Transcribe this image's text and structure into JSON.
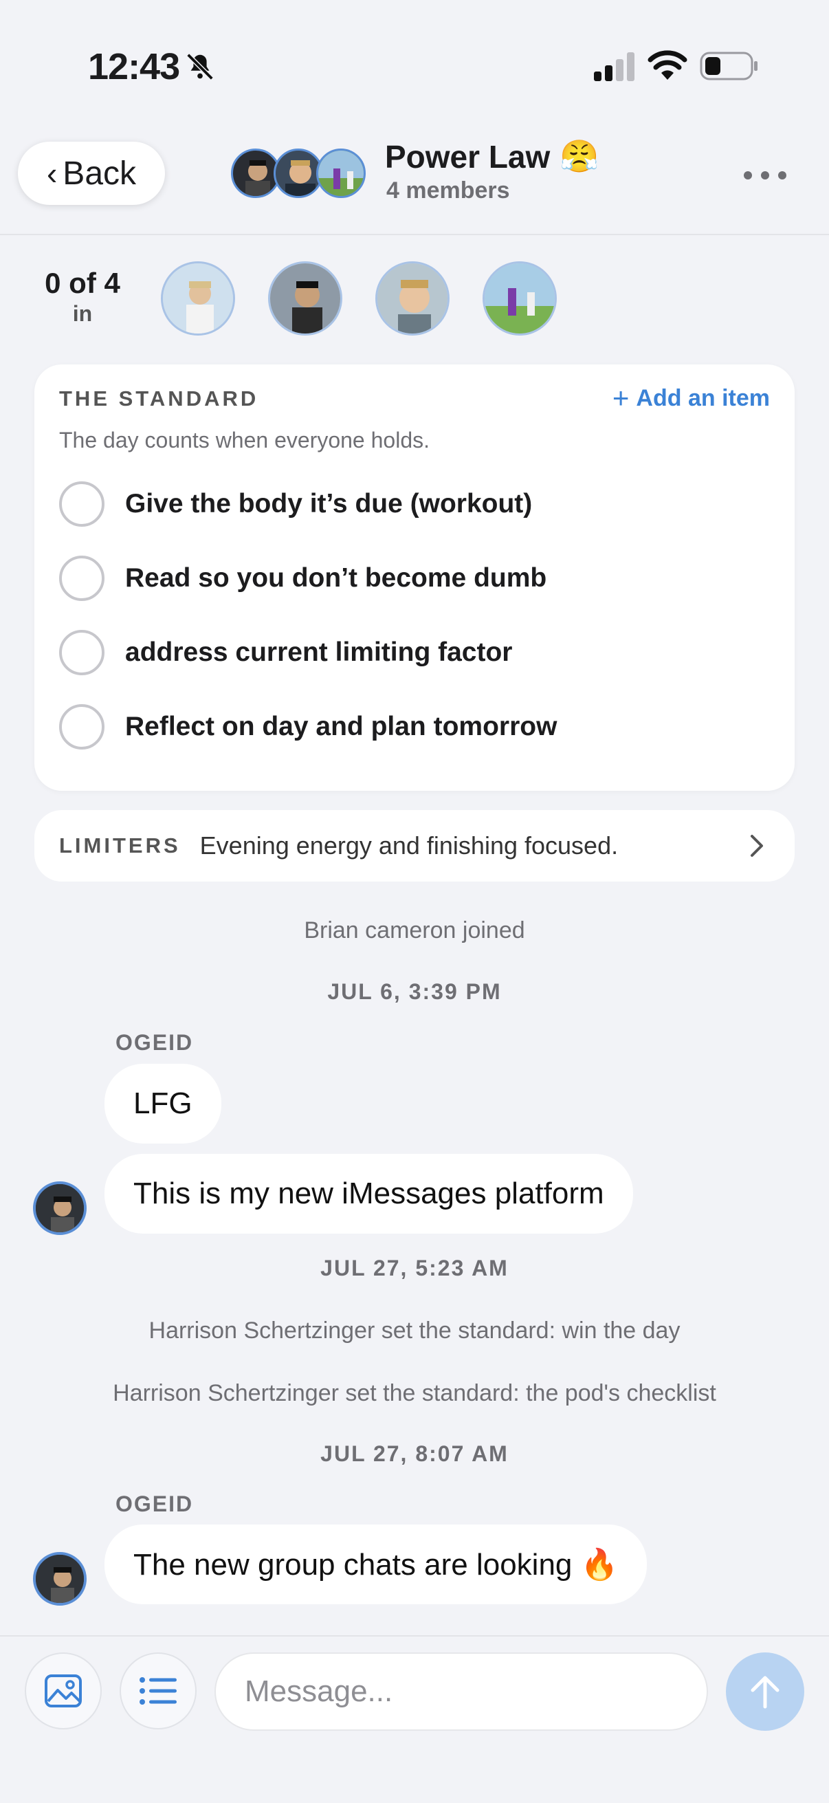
{
  "status_bar": {
    "time": "12:43"
  },
  "header": {
    "back_label": "Back",
    "group_name": "Power Law",
    "group_emoji": "😤",
    "member_count_text": "4 members"
  },
  "members_row": {
    "count": "0 of 4",
    "count_label": "in"
  },
  "standard": {
    "title": "THE STANDARD",
    "add_label": "Add an item",
    "subtitle": "The day counts when everyone holds.",
    "items": [
      {
        "label": "Give the body it’s due (workout)",
        "checked": false
      },
      {
        "label": "Read so you don’t become dumb",
        "checked": false
      },
      {
        "label": "address current limiting factor",
        "checked": false
      },
      {
        "label": "Reflect on day and plan tomorrow",
        "checked": false
      }
    ]
  },
  "limiters": {
    "label": "LIMITERS",
    "text": "Evening energy and finishing focused."
  },
  "chat": {
    "system_joined": "Brian cameron joined",
    "ts1": "JUL 6, 3:39 PM",
    "sender1": "OGEID",
    "msg1": "LFG",
    "msg2": "This is my new iMessages platform",
    "ts2": "JUL 27, 5:23 AM",
    "system_std1": "Harrison Schertzinger set the standard: win the day",
    "system_std2": "Harrison Schertzinger set the standard: the pod's checklist",
    "ts3": "JUL 27, 8:07 AM",
    "sender2": "OGEID",
    "msg3": "The new group chats are looking 🔥"
  },
  "composer": {
    "placeholder": "Message..."
  },
  "colors": {
    "accent": "#3b82d6",
    "background": "#f2f3f7",
    "send_button": "#b8d3f2"
  }
}
